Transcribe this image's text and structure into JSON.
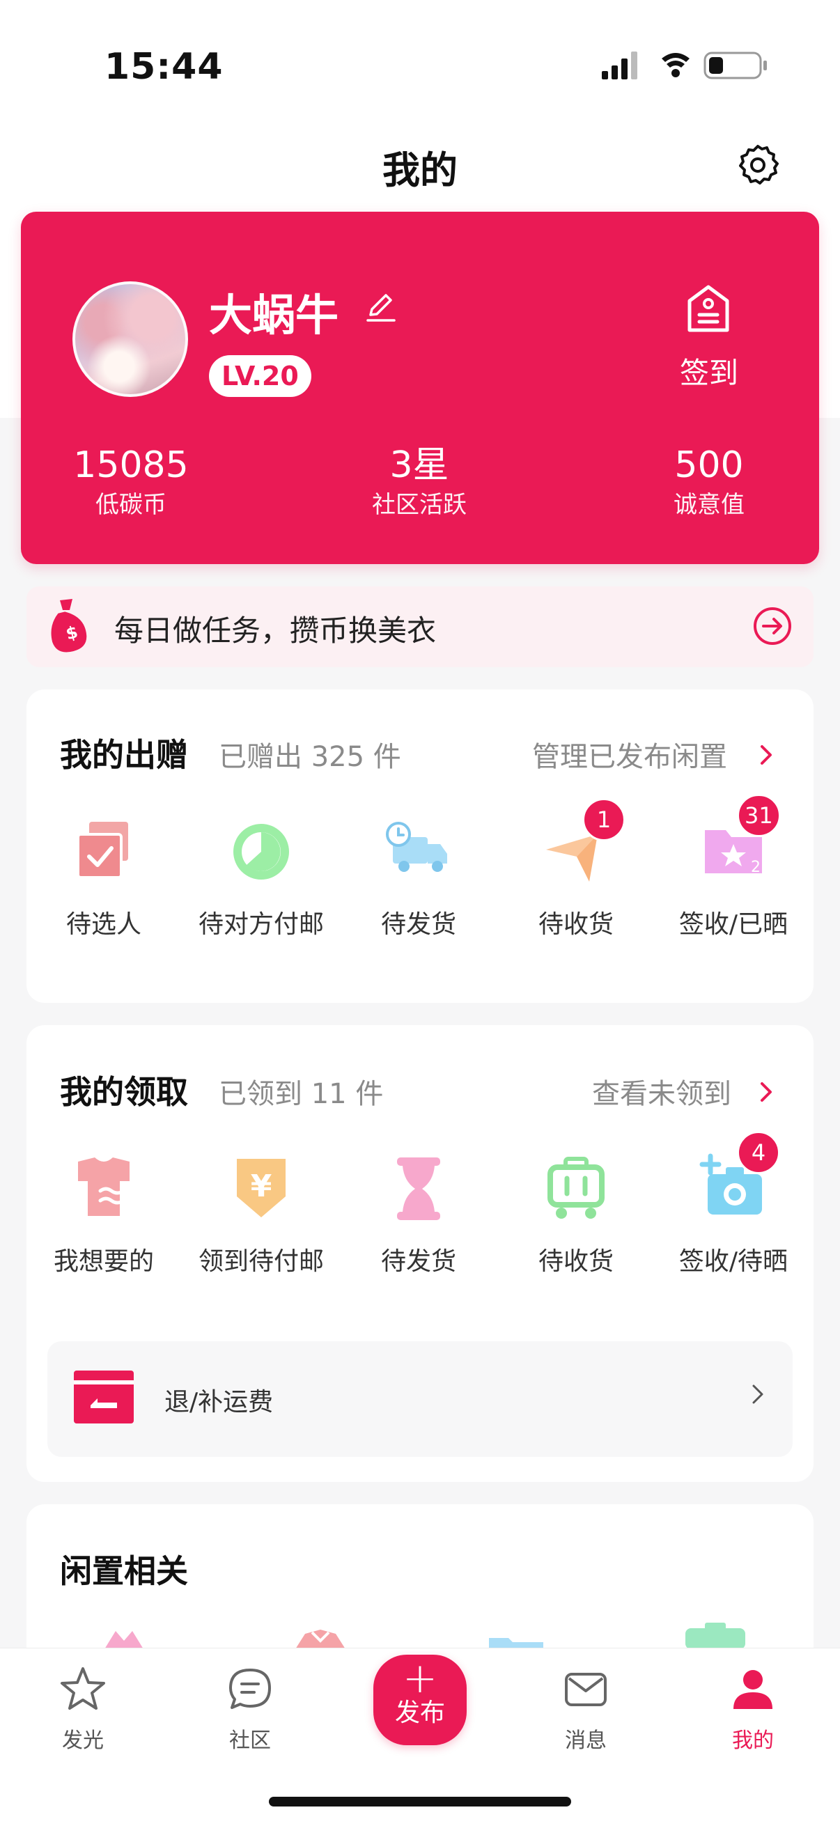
{
  "status_bar": {
    "time": "15:44"
  },
  "header": {
    "title": "我的"
  },
  "profile": {
    "username": "大蜗牛",
    "level": "LV.20",
    "checkin_label": "签到",
    "stats": [
      {
        "value": "15085",
        "label": "低碳币"
      },
      {
        "value": "3星",
        "label": "社区活跃"
      },
      {
        "value": "500",
        "label": "诚意值"
      }
    ]
  },
  "task_banner": {
    "text": "每日做任务，攒币换美衣"
  },
  "gift_section": {
    "title": "我的出赠",
    "subtitle": "已赠出 325 件",
    "link": "管理已发布闲置",
    "items": [
      {
        "label": "待选人",
        "icon": "checkbox-stack-icon",
        "badge": ""
      },
      {
        "label": "待对方付邮",
        "icon": "clock-circle-icon",
        "badge": ""
      },
      {
        "label": "待发货",
        "icon": "delivery-truck-icon",
        "badge": ""
      },
      {
        "label": "待收货",
        "icon": "paper-plane-icon",
        "badge": "1"
      },
      {
        "label": "签收/已晒",
        "icon": "star-folder-icon",
        "badge": "31"
      }
    ]
  },
  "claim_section": {
    "title": "我的领取",
    "subtitle": "已领到 11 件",
    "link": "查看未领到",
    "items": [
      {
        "label": "我想要的",
        "icon": "shirt-icon",
        "badge": ""
      },
      {
        "label": "领到待付邮",
        "icon": "yen-tag-icon",
        "badge": ""
      },
      {
        "label": "待发货",
        "icon": "hourglass-icon",
        "badge": ""
      },
      {
        "label": "待收货",
        "icon": "cart-icon",
        "badge": ""
      },
      {
        "label": "签收/待晒",
        "icon": "camera-plus-icon",
        "badge": "4"
      }
    ],
    "refund_label": "退/补运费"
  },
  "idle_section": {
    "title": "闲置相关"
  },
  "tabbar": {
    "items": [
      {
        "label": "发光",
        "icon": "star-icon"
      },
      {
        "label": "社区",
        "icon": "chat-bubble-icon"
      },
      {
        "label": "消息",
        "icon": "mail-icon"
      },
      {
        "label": "我的",
        "icon": "person-icon"
      }
    ],
    "publish_label": "发布",
    "publish_symbol": "+"
  },
  "colors": {
    "accent": "#ea1a55",
    "background": "#f6f6f7"
  }
}
